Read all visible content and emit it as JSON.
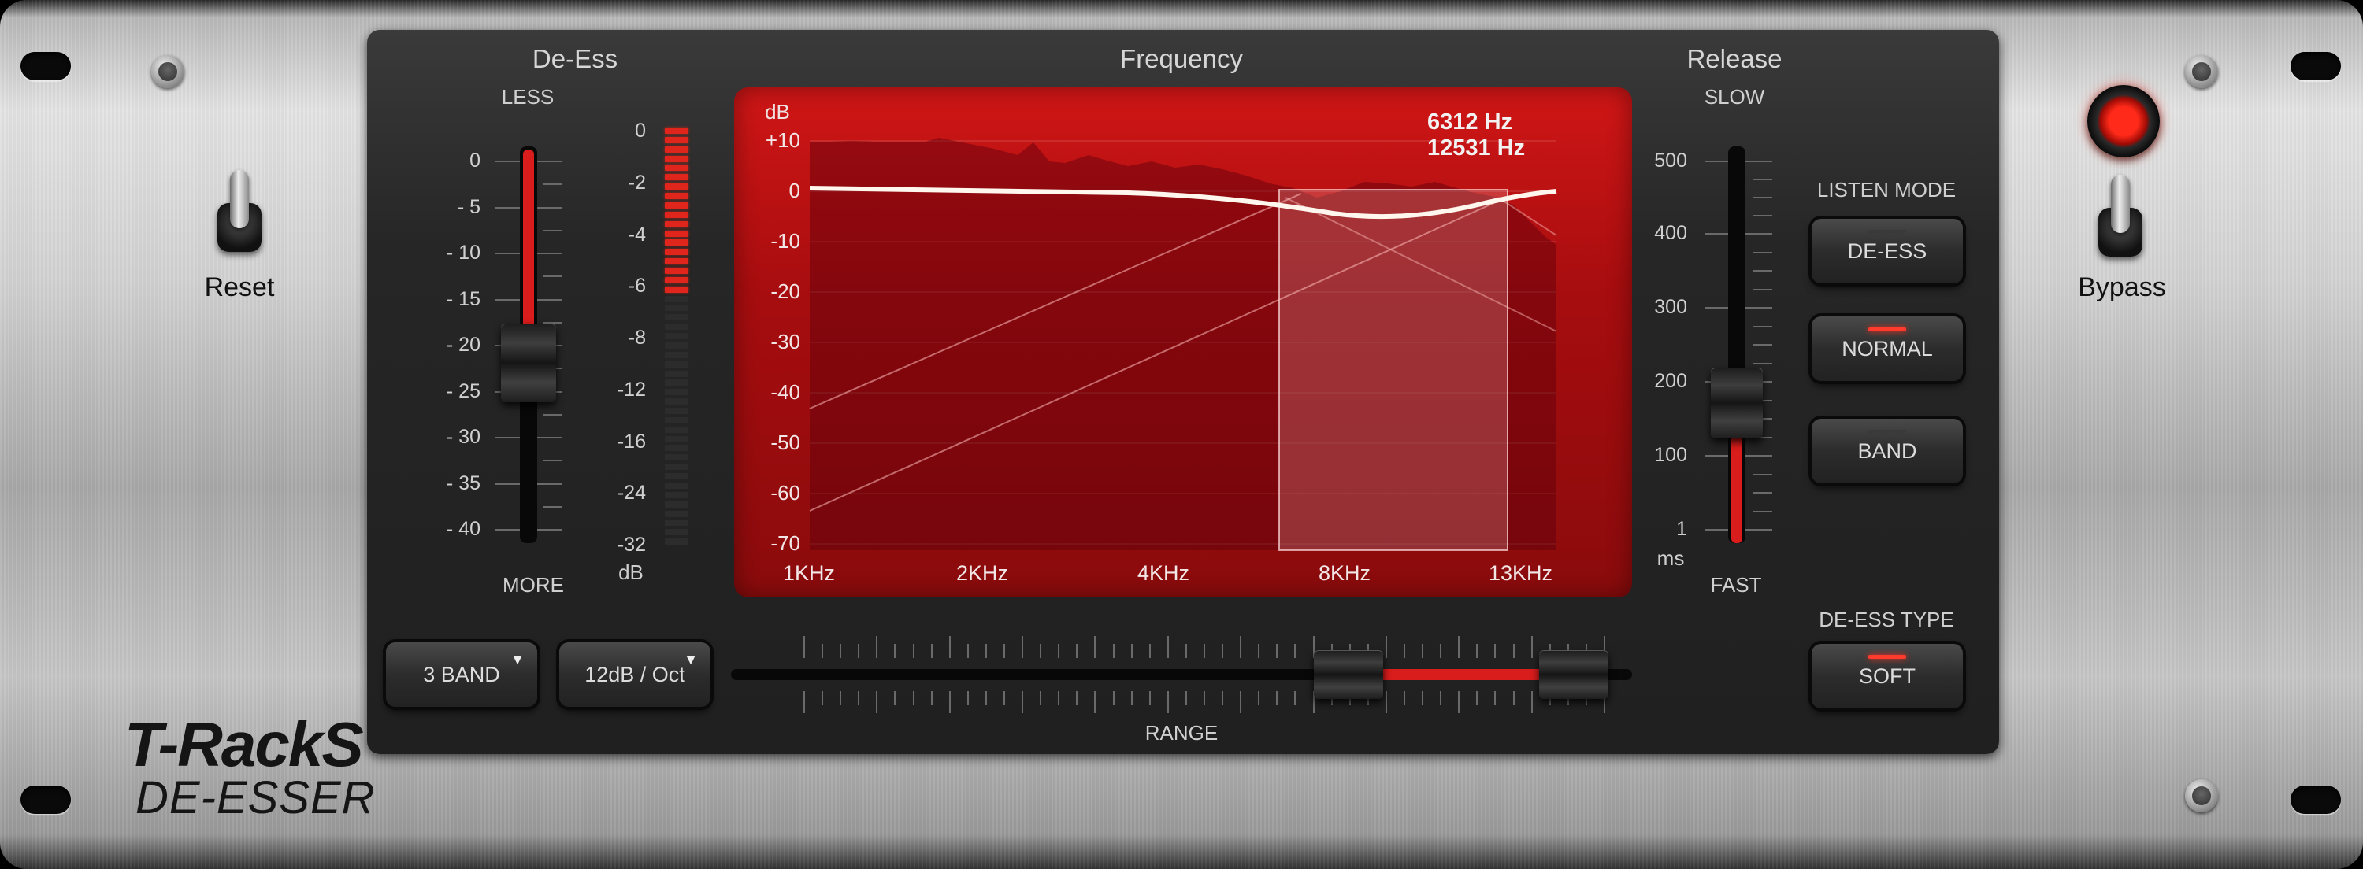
{
  "rack": {
    "reset_label": "Reset",
    "bypass_label": "Bypass",
    "logo_main": "T-RackS",
    "logo_sub": "DE-ESSER"
  },
  "de_ess": {
    "title": "De-Ess",
    "top_label": "LESS",
    "bottom_label": "MORE",
    "scale": [
      "0",
      "- 5",
      "- 10",
      "- 15",
      "- 20",
      "- 25",
      "- 30",
      "- 35",
      "- 40"
    ],
    "value": -22
  },
  "meter": {
    "scale": [
      "0",
      "-2",
      "-4",
      "-6",
      "-8",
      "-12",
      "-16",
      "-24",
      "-32"
    ],
    "unit": "dB",
    "level_db": -7
  },
  "frequency": {
    "title": "Frequency",
    "y_unit": "dB",
    "y_labels": [
      "+10",
      "0",
      "-10",
      "-20",
      "-30",
      "-40",
      "-50",
      "-60",
      "-70"
    ],
    "x_labels": [
      "1KHz",
      "2KHz",
      "4KHz",
      "8KHz",
      "13KHz"
    ],
    "readout_low": "6312 Hz",
    "readout_high": "12531 Hz"
  },
  "release": {
    "title": "Release",
    "top_label": "SLOW",
    "bottom_label": "FAST",
    "unit": "ms",
    "scale": [
      "500",
      "400",
      "300",
      "200",
      "100",
      "1"
    ],
    "value_ms": 170
  },
  "listen_mode": {
    "title": "LISTEN MODE",
    "buttons": [
      {
        "label": "DE-ESS",
        "active": false
      },
      {
        "label": "NORMAL",
        "active": true
      },
      {
        "label": "BAND",
        "active": false
      }
    ]
  },
  "de_ess_type": {
    "title": "DE-ESS TYPE",
    "value": "SOFT"
  },
  "band_select": {
    "value": "3 BAND"
  },
  "slope_select": {
    "value": "12dB / Oct"
  },
  "range": {
    "label": "RANGE",
    "low_hz": 6312,
    "high_hz": 12531
  },
  "colors": {
    "accent_red": "#d01616",
    "led_red": "#ff3b2e",
    "panel": "#262626"
  }
}
